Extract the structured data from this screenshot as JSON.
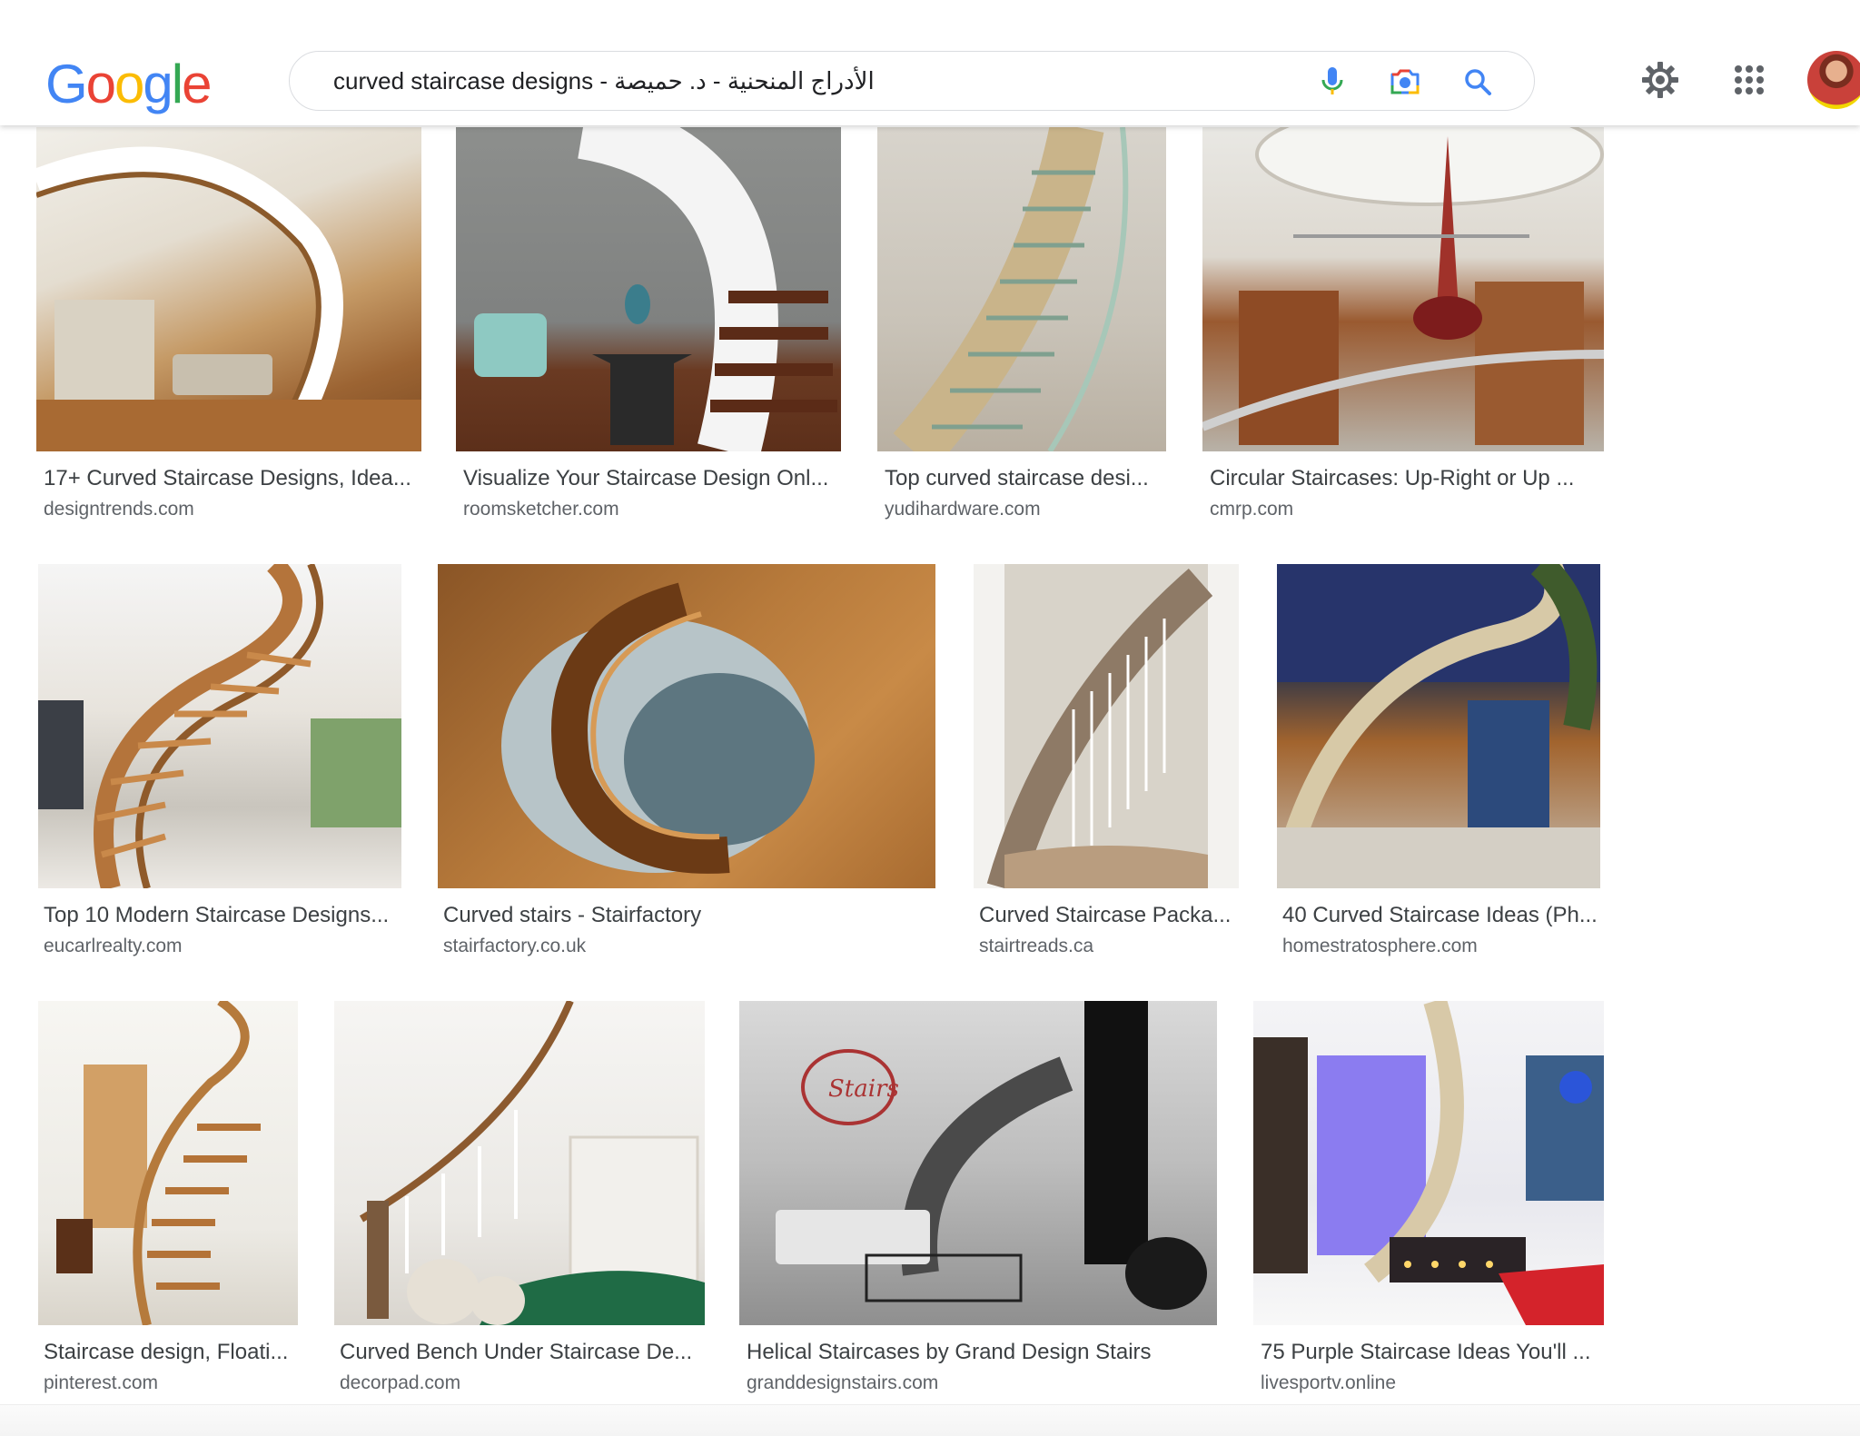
{
  "header": {
    "logo_text": "Google",
    "search_query": "curved staircase designs - الأدراج المنحنية - د. حميصة"
  },
  "icons": {
    "mic": "microphone-icon",
    "lens": "camera-lens-icon",
    "search": "search-icon",
    "settings": "gear-icon",
    "apps": "apps-grid-icon"
  },
  "colors": {
    "google_blue": "#4285F4",
    "google_red": "#EA4335",
    "google_yellow": "#FBBC05",
    "google_green": "#34A853"
  },
  "results": [
    {
      "title": "17+ Curved Staircase Designs, Idea...",
      "source": "designtrends.com"
    },
    {
      "title": "Visualize Your Staircase Design Onl...",
      "source": "roomsketcher.com"
    },
    {
      "title": "Top curved staircase desi...",
      "source": "yudihardware.com"
    },
    {
      "title": "Circular Staircases: Up-Right or Up ...",
      "source": "cmrp.com"
    },
    {
      "title": "Top 10 Modern Staircase Designs...",
      "source": "eucarlrealty.com"
    },
    {
      "title": "Curved stairs - Stairfactory",
      "source": "stairfactory.co.uk"
    },
    {
      "title": "Curved Staircase Packa...",
      "source": "stairtreads.ca"
    },
    {
      "title": "40 Curved Staircase Ideas (Ph...",
      "source": "homestratosphere.com"
    },
    {
      "title": "Staircase design, Floati...",
      "source": "pinterest.com"
    },
    {
      "title": "Curved Bench Under Staircase De...",
      "source": "decorpad.com"
    },
    {
      "title": "Helical Staircases by Grand Design Stairs",
      "source": "granddesignstairs.com"
    },
    {
      "title": "75 Purple Staircase Ideas You'll ...",
      "source": "livesportv.online"
    }
  ]
}
